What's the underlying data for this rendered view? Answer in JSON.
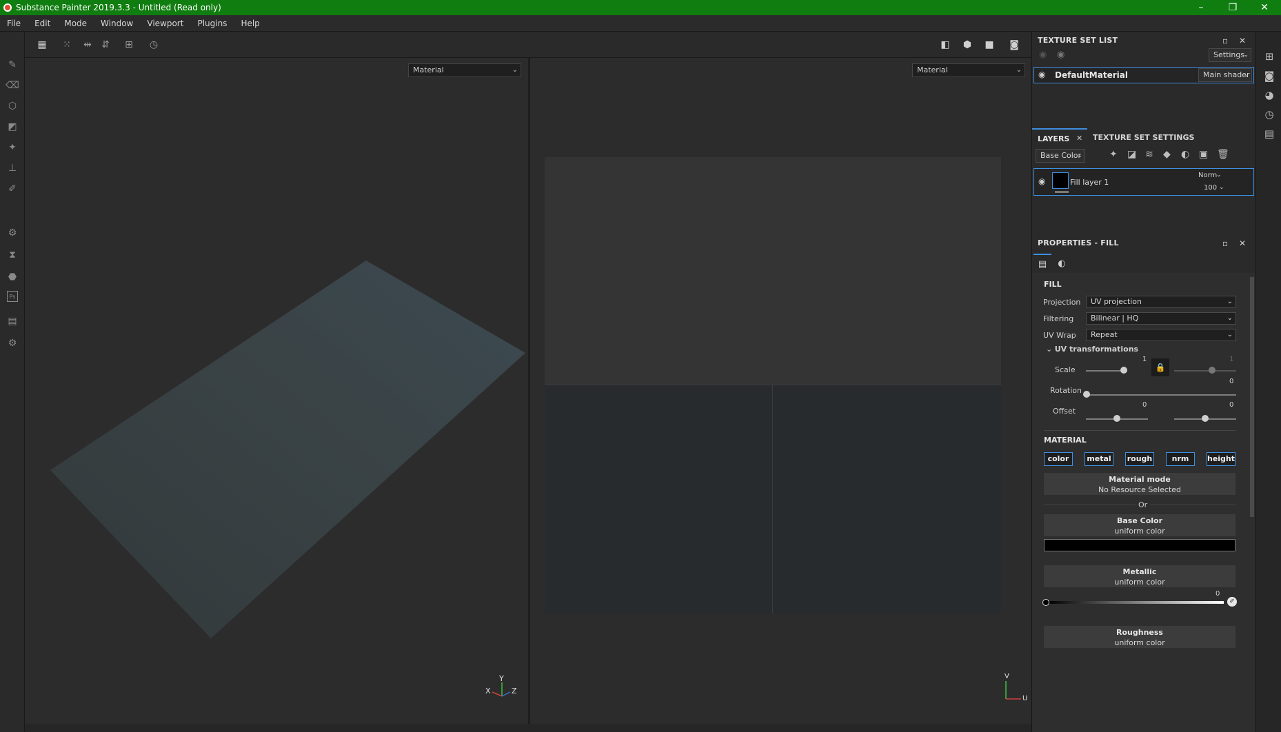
{
  "window": {
    "title": "Substance Painter 2019.3.3 - Untitled (Read only)",
    "controls": {
      "minimize": "–",
      "restore": "❐",
      "close": "✕"
    }
  },
  "menu": [
    "File",
    "Edit",
    "Mode",
    "Window",
    "Viewport",
    "Plugins",
    "Help"
  ],
  "viewport3d": {
    "mode": "Material",
    "axes": {
      "x": "X",
      "y": "Y",
      "z": "Z"
    }
  },
  "viewport2d": {
    "mode": "Material",
    "axes": {
      "u": "U",
      "v": "V"
    }
  },
  "texture_set_list": {
    "title": "TEXTURE SET LIST",
    "settings_label": "Settings",
    "items": [
      {
        "name": "DefaultMaterial",
        "shader": "Main shader"
      }
    ]
  },
  "layers": {
    "tabs": [
      "LAYERS",
      "TEXTURE SET SETTINGS"
    ],
    "channel": "Base Color",
    "items": [
      {
        "name": "Fill layer 1",
        "blend": "Norm",
        "opacity": "100"
      }
    ]
  },
  "properties": {
    "title": "PROPERTIES - FILL",
    "fill": {
      "section": "FILL",
      "projection_label": "Projection",
      "projection": "UV projection",
      "filtering_label": "Filtering",
      "filtering": "Bilinear | HQ",
      "uvwrap_label": "UV Wrap",
      "uvwrap": "Repeat",
      "uvtrans_label": "UV transformations",
      "scale_label": "Scale",
      "scale_u": "1",
      "scale_v": "1",
      "rotation_label": "Rotation",
      "rotation": "0",
      "offset_label": "Offset",
      "offset_u": "0",
      "offset_v": "0"
    },
    "material": {
      "section": "MATERIAL",
      "chips": [
        "color",
        "metal",
        "rough",
        "nrm",
        "height"
      ],
      "mode_title": "Material mode",
      "mode_value": "No Resource Selected",
      "or_label": "Or",
      "base_color_title": "Base Color",
      "base_color_sub": "uniform color",
      "metallic_title": "Metallic",
      "metallic_sub": "uniform color",
      "metallic_value": "0",
      "roughness_title": "Roughness",
      "roughness_sub": "uniform color"
    }
  },
  "colors": {
    "titlebar": "#0f7d0f",
    "accent": "#3e8fe0",
    "panel": "#2a2a2a",
    "viewport": "#2c2c2c"
  }
}
